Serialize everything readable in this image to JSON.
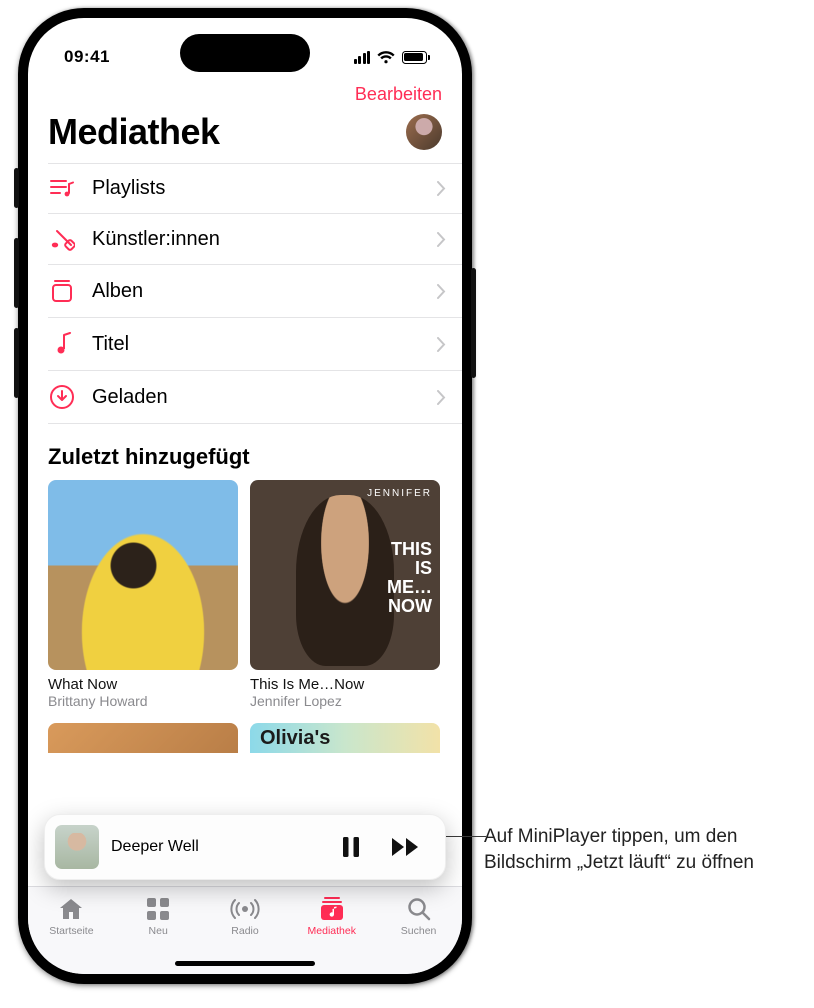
{
  "status": {
    "time": "09:41"
  },
  "header": {
    "edit": "Bearbeiten",
    "title": "Mediathek"
  },
  "menu": [
    {
      "label": "Playlists",
      "icon": "playlist-icon"
    },
    {
      "label": "Künstler:innen",
      "icon": "artist-icon"
    },
    {
      "label": "Alben",
      "icon": "album-icon"
    },
    {
      "label": "Titel",
      "icon": "song-icon"
    },
    {
      "label": "Geladen",
      "icon": "downloaded-icon"
    }
  ],
  "recent": {
    "heading": "Zuletzt hinzugefügt",
    "albums": [
      {
        "title": "What Now",
        "artist": "Brittany Howard",
        "cover_overline": "",
        "cover_main": ""
      },
      {
        "title": "This Is Me…Now",
        "artist": "Jennifer Lopez",
        "cover_overline": "JENNIFER",
        "cover_main": "THIS\nIS\nME…\nNOW"
      }
    ],
    "peek": [
      {
        "label": ""
      },
      {
        "label": "Olivia's"
      }
    ]
  },
  "miniplayer": {
    "track": "Deeper Well"
  },
  "tabs": [
    {
      "label": "Startseite",
      "icon": "home-icon",
      "active": false
    },
    {
      "label": "Neu",
      "icon": "browse-icon",
      "active": false
    },
    {
      "label": "Radio",
      "icon": "radio-icon",
      "active": false
    },
    {
      "label": "Mediathek",
      "icon": "library-icon",
      "active": true
    },
    {
      "label": "Suchen",
      "icon": "search-icon",
      "active": false
    }
  ],
  "callout": {
    "text": "Auf MiniPlayer tippen, um den Bildschirm „Jetzt läuft“ zu öffnen"
  }
}
